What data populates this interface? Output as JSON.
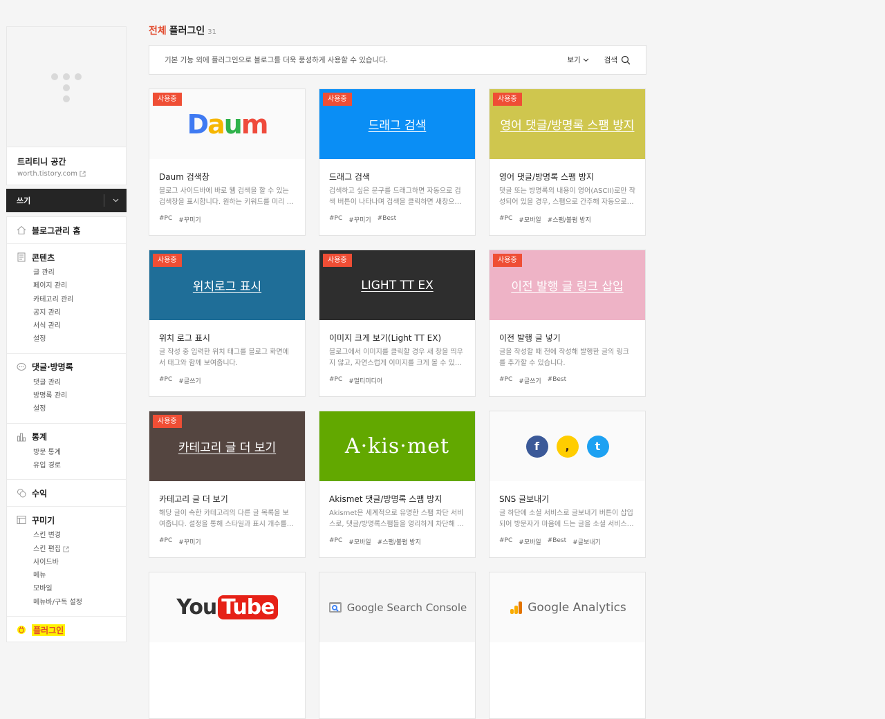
{
  "sidebar": {
    "blog_name": "트리티니 공간",
    "blog_url": "worth.tistory.com",
    "write_label": "쓰기",
    "menu": {
      "home": "블로그관리 홈",
      "contents": {
        "label": "콘텐츠",
        "items": [
          "글 관리",
          "페이지 관리",
          "카테고리 관리",
          "공지 관리",
          "서식 관리",
          "설정"
        ]
      },
      "comments": {
        "label": "댓글·방명록",
        "items": [
          "댓글 관리",
          "방명록 관리",
          "설정"
        ]
      },
      "stats": {
        "label": "통계",
        "items": [
          "방문 통계",
          "유입 경로"
        ]
      },
      "revenue": "수익",
      "decor": {
        "label": "꾸미기",
        "items": [
          "스킨 변경",
          "스킨 편집",
          "사이드바",
          "메뉴",
          "모바일",
          "메뉴바/구독 설정"
        ]
      },
      "plugin": "플러그인"
    }
  },
  "main": {
    "title_accent": "전체",
    "title_rest": "플러그인",
    "count": "31",
    "description": "기본 기능 외에 플러그인으로 블로그를 더욱 풍성하게 사용할 수 있습니다.",
    "view_label": "보기",
    "search_label": "검색",
    "badge_label": "사용중",
    "cards": [
      {
        "thumb_bg": "#fafafa",
        "thumb_text": "",
        "logo": "daum",
        "logo_text": [
          "D",
          "a",
          "u",
          "m"
        ],
        "name": "Daum 검색창",
        "summary": "블로그 사이드바에 바로 웹 검색을 할 수 있는 검색창을 표시합니다. 원하는 키워드를 미리 …",
        "tags": [
          "#PC",
          "#꾸미기"
        ],
        "in_use": true
      },
      {
        "thumb_bg": "#0a8ef5",
        "thumb_text": "드래그 검색",
        "name": "드래그 검색",
        "summary": "검색하고 싶은 문구를 드래그하면 자동으로 검색 버튼이 나타나며 검색을 클릭하면 새창으…",
        "tags": [
          "#PC",
          "#꾸미기",
          "#Best"
        ],
        "in_use": true
      },
      {
        "thumb_bg": "#cfc64e",
        "thumb_text": "영어 댓글/방명록 스팸 방지",
        "name": "영어 댓글/방명록 스팸 방지",
        "summary": "댓글 또는 방명록의 내용이 영어(ASCII)로만 작성되어 있을 경우, 스팸으로 간주해 자동으로…",
        "tags": [
          "#PC",
          "#모바일",
          "#스팸/불펌 방지"
        ],
        "in_use": true
      },
      {
        "thumb_bg": "#1f6e98",
        "thumb_text": "위치로그 표시",
        "name": "위치 로그 표시",
        "summary": "글 작성 중 입력한 위치 태그를 블로그 화면에서 태그와 함께 보여줍니다.",
        "tags": [
          "#PC",
          "#글쓰기"
        ],
        "in_use": true
      },
      {
        "thumb_bg": "#2e2e2e",
        "thumb_text": "LIGHT TT EX",
        "name": "이미지 크게 보기(Light TT EX)",
        "summary": "블로그에서 이미지를 클릭할 경우 새 창을 띄우지 않고, 자연스럽게 이미지를 크게 볼 수 있…",
        "tags": [
          "#PC",
          "#멀티미디어"
        ],
        "in_use": true
      },
      {
        "thumb_bg": "#eeb3c6",
        "thumb_text": "이전 발행 글 링크 삽입",
        "name": "이전 발행 글 넣기",
        "summary": "글을 작성할 때 전에 작성해 발행한 글의 링크를 추가할 수 있습니다.",
        "tags": [
          "#PC",
          "#글쓰기",
          "#Best"
        ],
        "in_use": true
      },
      {
        "thumb_bg": "#544540",
        "thumb_text": "카테고리 글 더 보기",
        "name": "카테고리 글 더 보기",
        "summary": "해당 글이 속한 카테고리의 다른 글 목록을 보여줍니다. 설정을 통해 스타일과 표시 개수를 …",
        "tags": [
          "#PC",
          "#꾸미기"
        ],
        "in_use": true
      },
      {
        "thumb_bg": "#62a800",
        "thumb_text": "",
        "logo": "akismet",
        "logo_text": "A·kis·met",
        "name": "Akismet 댓글/방명록 스팸 방지",
        "summary": "Akismet은 세계적으로 유명한 스팸 차단 서비스로, 댓글/방명록스팸들을 영리하게 차단해 …",
        "tags": [
          "#PC",
          "#모바일",
          "#스팸/불펌 방지"
        ],
        "in_use": false
      },
      {
        "thumb_bg": "#fafafa",
        "thumb_text": "",
        "logo": "sns",
        "logo_text": [
          "f",
          ",",
          "t"
        ],
        "name": "SNS 글보내기",
        "summary": "글 하단에 소셜 서비스로 글보내기 버튼이 삽입되어 방문자가 마음에 드는 글을 소셜 서비스…",
        "tags": [
          "#PC",
          "#모바일",
          "#Best",
          "#글보내기"
        ],
        "in_use": false
      },
      {
        "thumb_bg": "#fafafa",
        "thumb_text": "",
        "logo": "youtube",
        "logo_text": [
          "You",
          "Tube"
        ],
        "name": "",
        "summary": "",
        "tags": [],
        "in_use": false
      },
      {
        "thumb_bg": "#f5f5f5",
        "thumb_text": "",
        "logo": "gsc",
        "logo_text": "Google Search Console",
        "name": "",
        "summary": "",
        "tags": [],
        "in_use": false
      },
      {
        "thumb_bg": "#fafafa",
        "thumb_text": "",
        "logo": "ga",
        "logo_text": "Google Analytics",
        "name": "",
        "summary": "",
        "tags": [],
        "in_use": false
      }
    ]
  },
  "colors": {
    "accent": "#e24a2d",
    "badge": "#ef4e35",
    "highlight": "#fff200",
    "write_bar": "#252525"
  }
}
